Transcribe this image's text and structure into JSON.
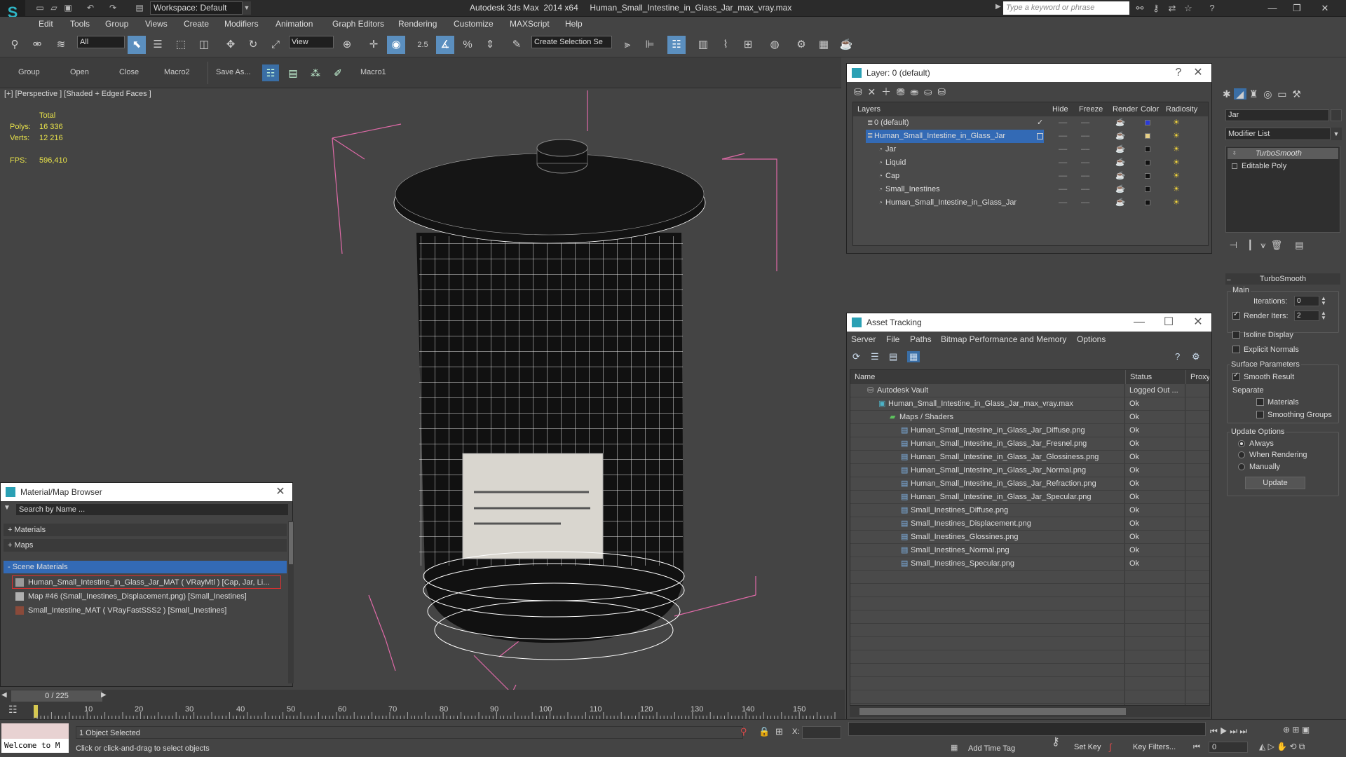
{
  "app": {
    "title": "Autodesk 3ds Max  2014 x64     Human_Small_Intestine_in_Glass_Jar_max_vray.max",
    "workspace": "Workspace: Default",
    "search_placeholder": "Type a keyword or phrase"
  },
  "menu": [
    "Edit",
    "Tools",
    "Group",
    "Views",
    "Create",
    "Modifiers",
    "Animation",
    "Graph Editors",
    "Rendering",
    "Customize",
    "MAXScript",
    "Help"
  ],
  "toolbar": {
    "filter_select": "All",
    "view_select": "View",
    "snap_value": "2.5",
    "selection_set": "Create Selection Se"
  },
  "shelf": [
    "Group",
    "Open",
    "Close",
    "Macro2",
    "Save As...",
    "Macro1"
  ],
  "viewport": {
    "label": "[+] [Perspective ] [Shaded + Edged Faces ]",
    "total_label": "Total",
    "polys_label": "Polys:",
    "polys_value": "16 336",
    "verts_label": "Verts:",
    "verts_value": "12 216",
    "fps_label": "FPS:",
    "fps_value": "596,410"
  },
  "layer_panel": {
    "title": "Layer: 0 (default)",
    "columns": [
      "Layers",
      "Hide",
      "Freeze",
      "Render",
      "Color",
      "Radiosity"
    ],
    "rows": [
      {
        "name": "0 (default)",
        "indent": 0,
        "color": "#2b3bd6",
        "current": true,
        "selected": false
      },
      {
        "name": "Human_Small_Intestine_in_Glass_Jar",
        "indent": 0,
        "color": "#e6cf86",
        "current": false,
        "selected": true
      },
      {
        "name": "Jar",
        "indent": 1,
        "color": "#111111",
        "current": false,
        "selected": false
      },
      {
        "name": "Liquid",
        "indent": 1,
        "color": "#111111",
        "current": false,
        "selected": false
      },
      {
        "name": "Cap",
        "indent": 1,
        "color": "#111111",
        "current": false,
        "selected": false
      },
      {
        "name": "Small_Inestines",
        "indent": 1,
        "color": "#111111",
        "current": false,
        "selected": false
      },
      {
        "name": "Human_Small_Intestine_in_Glass_Jar",
        "indent": 1,
        "color": "#111111",
        "current": false,
        "selected": false
      }
    ]
  },
  "asset_panel": {
    "title": "Asset Tracking",
    "menu": [
      "Server",
      "File",
      "Paths",
      "Bitmap Performance and Memory",
      "Options"
    ],
    "columns": [
      "Name",
      "Status",
      "Proxy"
    ],
    "rows": [
      {
        "name": "Autodesk Vault",
        "indent": 0,
        "status": "Logged Out ..."
      },
      {
        "name": "Human_Small_Intestine_in_Glass_Jar_max_vray.max",
        "indent": 1,
        "status": "Ok"
      },
      {
        "name": "Maps / Shaders",
        "indent": 2,
        "status": "Ok"
      },
      {
        "name": "Human_Small_Intestine_in_Glass_Jar_Diffuse.png",
        "indent": 3,
        "status": "Ok"
      },
      {
        "name": "Human_Small_Intestine_in_Glass_Jar_Fresnel.png",
        "indent": 3,
        "status": "Ok"
      },
      {
        "name": "Human_Small_Intestine_in_Glass_Jar_Glossiness.png",
        "indent": 3,
        "status": "Ok"
      },
      {
        "name": "Human_Small_Intestine_in_Glass_Jar_Normal.png",
        "indent": 3,
        "status": "Ok"
      },
      {
        "name": "Human_Small_Intestine_in_Glass_Jar_Refraction.png",
        "indent": 3,
        "status": "Ok"
      },
      {
        "name": "Human_Small_Intestine_in_Glass_Jar_Specular.png",
        "indent": 3,
        "status": "Ok"
      },
      {
        "name": "Small_Inestines_Diffuse.png",
        "indent": 3,
        "status": "Ok"
      },
      {
        "name": "Small_Inestines_Displacement.png",
        "indent": 3,
        "status": "Ok"
      },
      {
        "name": "Small_Inestines_Glossines.png",
        "indent": 3,
        "status": "Ok"
      },
      {
        "name": "Small_Inestines_Normal.png",
        "indent": 3,
        "status": "Ok"
      },
      {
        "name": "Small_Inestines_Specular.png",
        "indent": 3,
        "status": "Ok"
      }
    ]
  },
  "material_browser": {
    "title": "Material/Map Browser",
    "search_placeholder": "Search by Name ...",
    "sections": [
      "+ Materials",
      "+ Maps",
      "- Scene Materials"
    ],
    "items": [
      {
        "label": "Human_Small_Intestine_in_Glass_Jar_MAT  ( VRayMtl ) [Cap, Jar, Li...",
        "swatch": "#9a9a9a",
        "selected": true
      },
      {
        "label": "Map #46 (Small_Inestines_Displacement.png) [Small_Inestines]",
        "swatch": "#b0b0b0",
        "selected": false
      },
      {
        "label": "Small_Intestine_MAT  ( VRayFastSSS2 ) [Small_Inestines]",
        "swatch": "#8a4a3a",
        "selected": false
      }
    ]
  },
  "command_panel": {
    "object_name": "Jar",
    "modifier_list": "Modifier List",
    "stack": [
      "TurboSmooth",
      "Editable Poly"
    ],
    "rollout_title": "TurboSmooth",
    "main_label": "Main",
    "iterations_label": "Iterations:",
    "iterations_value": "0",
    "render_iters_label": "Render Iters:",
    "render_iters_value": "2",
    "isoline_label": "Isoline Display",
    "explicit_label": "Explicit Normals",
    "surface_label": "Surface Parameters",
    "smooth_label": "Smooth Result",
    "separate_label": "Separate",
    "materials_label": "Materials",
    "smoothing_label": "Smoothing Groups",
    "update_options_label": "Update Options",
    "always_label": "Always",
    "when_rendering_label": "When Rendering",
    "manually_label": "Manually",
    "update_button": "Update"
  },
  "timeline": {
    "frame_counter": "0 / 225",
    "ticks": [
      "10",
      "20",
      "30",
      "40",
      "50",
      "60",
      "70",
      "80",
      "90",
      "100",
      "110",
      "120",
      "130",
      "140",
      "150"
    ]
  },
  "status": {
    "welcome": "Welcome to M",
    "selected": "1 Object Selected",
    "hint": "Click or click-and-drag to select objects",
    "x_label": "X:",
    "add_time_tag": "Add Time Tag",
    "set_key": "Set Key",
    "key_filters": "Key Filters...",
    "frame_value": "0"
  }
}
